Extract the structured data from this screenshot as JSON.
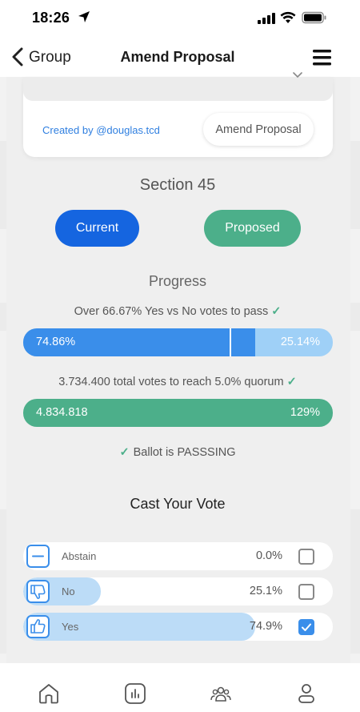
{
  "status_bar": {
    "time": "18:26"
  },
  "nav": {
    "back_label": "Group",
    "title": "Amend Proposal"
  },
  "proposal_card": {
    "created_by": "Created by @douglas.tcd",
    "amend_button": "Amend Proposal"
  },
  "section": {
    "title": "Section 45",
    "current_button": "Current",
    "proposed_button": "Proposed"
  },
  "progress": {
    "title": "Progress",
    "pass_rule": "Over 66.67% Yes vs No votes to pass",
    "yes_pct": "74.86%",
    "no_pct": "25.14%",
    "yes_fraction": 0.7486,
    "threshold_fraction": 0.6667,
    "quorum_rule": "3.734.400 total votes to reach 5.0% quorum",
    "total_votes": "4.834.818",
    "quorum_pct": "129%",
    "ballot_status": "Ballot is PASSSING"
  },
  "vote": {
    "title": "Cast Your Vote",
    "options": [
      {
        "label": "Abstain",
        "pct": "0.0%",
        "fraction": 0.0,
        "checked": false,
        "icon": "minus-icon"
      },
      {
        "label": "No",
        "pct": "25.1%",
        "fraction": 0.251,
        "checked": false,
        "icon": "thumbs-down-icon"
      },
      {
        "label": "Yes",
        "pct": "74.9%",
        "fraction": 0.749,
        "checked": true,
        "icon": "thumbs-up-icon"
      }
    ]
  },
  "tabs": [
    "home-icon",
    "chart-icon",
    "group-icon",
    "profile-icon"
  ],
  "colors": {
    "primary_blue": "#1565e0",
    "bar_blue": "#3a8eea",
    "light_blue": "#9fd0f7",
    "green": "#4caf8a"
  }
}
